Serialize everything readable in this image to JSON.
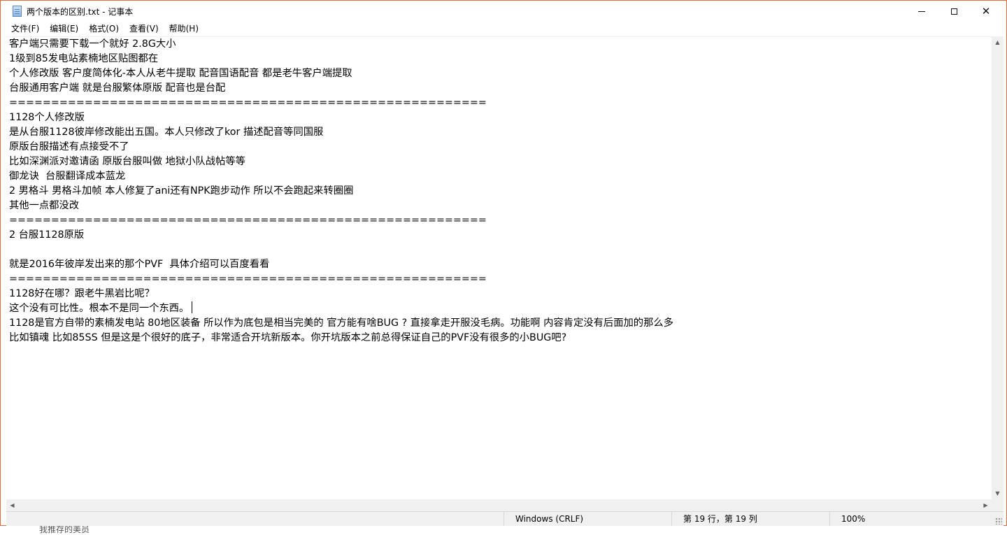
{
  "window": {
    "title": "两个版本的区别.txt - 记事本"
  },
  "menu": [
    "文件(F)",
    "编辑(E)",
    "格式(O)",
    "查看(V)",
    "帮助(H)"
  ],
  "editor": {
    "lines": [
      "客户端只需要下载一个就好 2.8G大小",
      "1级到85发电站素楠地区贴图都在",
      "个人修改版 客户度简体化-本人从老牛提取 配音国语配音 都是老牛客户端提取",
      "台服通用客户端 就是台服繁体原版 配音也是台配",
      "=========================================================",
      "1128个人修改版",
      "是从台服1128彼岸修改能出五国。本人只修改了kor 描述配音等同国服",
      "原版台服描述有点接受不了",
      "比如深渊派对邀请函 原版台服叫做 地狱小队战帖等等",
      "御龙诀  台服翻译成本蓝龙",
      "2 男格斗 男格斗加帧 本人修复了ani还有NPK跑步动作 所以不会跑起来转圈圈",
      "其他一点都没改",
      "=========================================================",
      "2 台服1128原版",
      "",
      "就是2016年彼岸发出来的那个PVF  具体介绍可以百度看看",
      "=========================================================",
      "1128好在哪？跟老牛黑岩比呢？",
      "这个没有可比性。根本不是同一个东西。",
      "1128是官方自带的素楠发电站 80地区装备 所以作为底包是相当完美的 官方能有啥BUG ? 直接拿走开服没毛病。功能啊 内容肯定没有后面加的那么多",
      "比如镇魂 比如85SS 但是这是个很好的底子，非常适合开坑新版本。你开坑版本之前总得保证自己的PVF没有很多的小BUG吧?"
    ],
    "caret_line": 19
  },
  "status": {
    "encoding": "Windows (CRLF)",
    "position": "第 19 行，第 19 列",
    "zoom": "100%"
  },
  "background_window": {
    "partial_text": "我推存的美员"
  }
}
